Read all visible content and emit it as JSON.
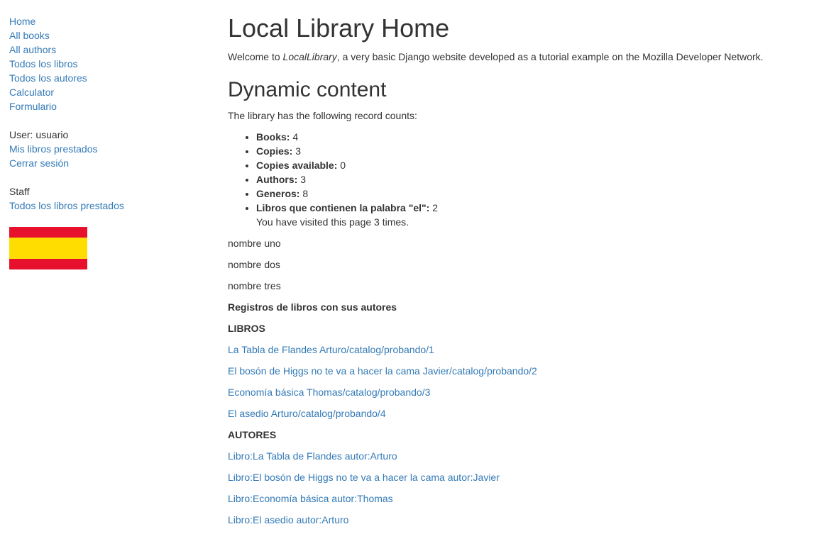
{
  "sidebar": {
    "nav": [
      "Home",
      "All books",
      "All authors",
      "Todos los libros",
      "Todos los autores",
      "Calculator",
      "Formulario"
    ],
    "user_label": "User: usuario",
    "user_links": [
      "Mis libros prestados",
      "Cerrar sesión"
    ],
    "staff_label": "Staff",
    "staff_links": [
      "Todos los libros prestados"
    ],
    "flag": {
      "name": "spain-flag",
      "colors": [
        "#e8112d",
        "#ffdd00",
        "#e8112d"
      ]
    }
  },
  "main": {
    "title": "Local Library Home",
    "welcome_prefix": "Welcome to ",
    "welcome_site": "LocalLibrary",
    "welcome_suffix": ", a very basic Django website developed as a tutorial example on the Mozilla Developer Network.",
    "dynamic_heading": "Dynamic content",
    "counts_intro": "The library has the following record counts:",
    "counts": [
      {
        "label": "Books:",
        "value": "4"
      },
      {
        "label": "Copies:",
        "value": "3"
      },
      {
        "label": "Copies available:",
        "value": "0"
      },
      {
        "label": "Authors:",
        "value": "3"
      },
      {
        "label": "Generos:",
        "value": "8"
      },
      {
        "label": "Libros que contienen la palabra \"el\":",
        "value": "2"
      }
    ],
    "visited": "You have visited this page 3 times.",
    "names": [
      "nombre uno",
      "nombre dos",
      "nombre tres"
    ],
    "records_heading": "Registros de libros con sus autores",
    "books_heading": "LIBROS",
    "books": [
      "La Tabla de Flandes Arturo/catalog/probando/1",
      "El bosón de Higgs no te va a hacer la cama Javier/catalog/probando/2",
      "Economía básica Thomas/catalog/probando/3",
      "El asedio Arturo/catalog/probando/4"
    ],
    "authors_heading": "AUTORES",
    "authors": [
      "Libro:La Tabla de Flandes autor:Arturo",
      "Libro:El bosón de Higgs no te va a hacer la cama autor:Javier",
      "Libro:Economía básica autor:Thomas",
      "Libro:El asedio autor:Arturo"
    ]
  },
  "colors": {
    "link": "#337ab7",
    "text": "#333333"
  }
}
